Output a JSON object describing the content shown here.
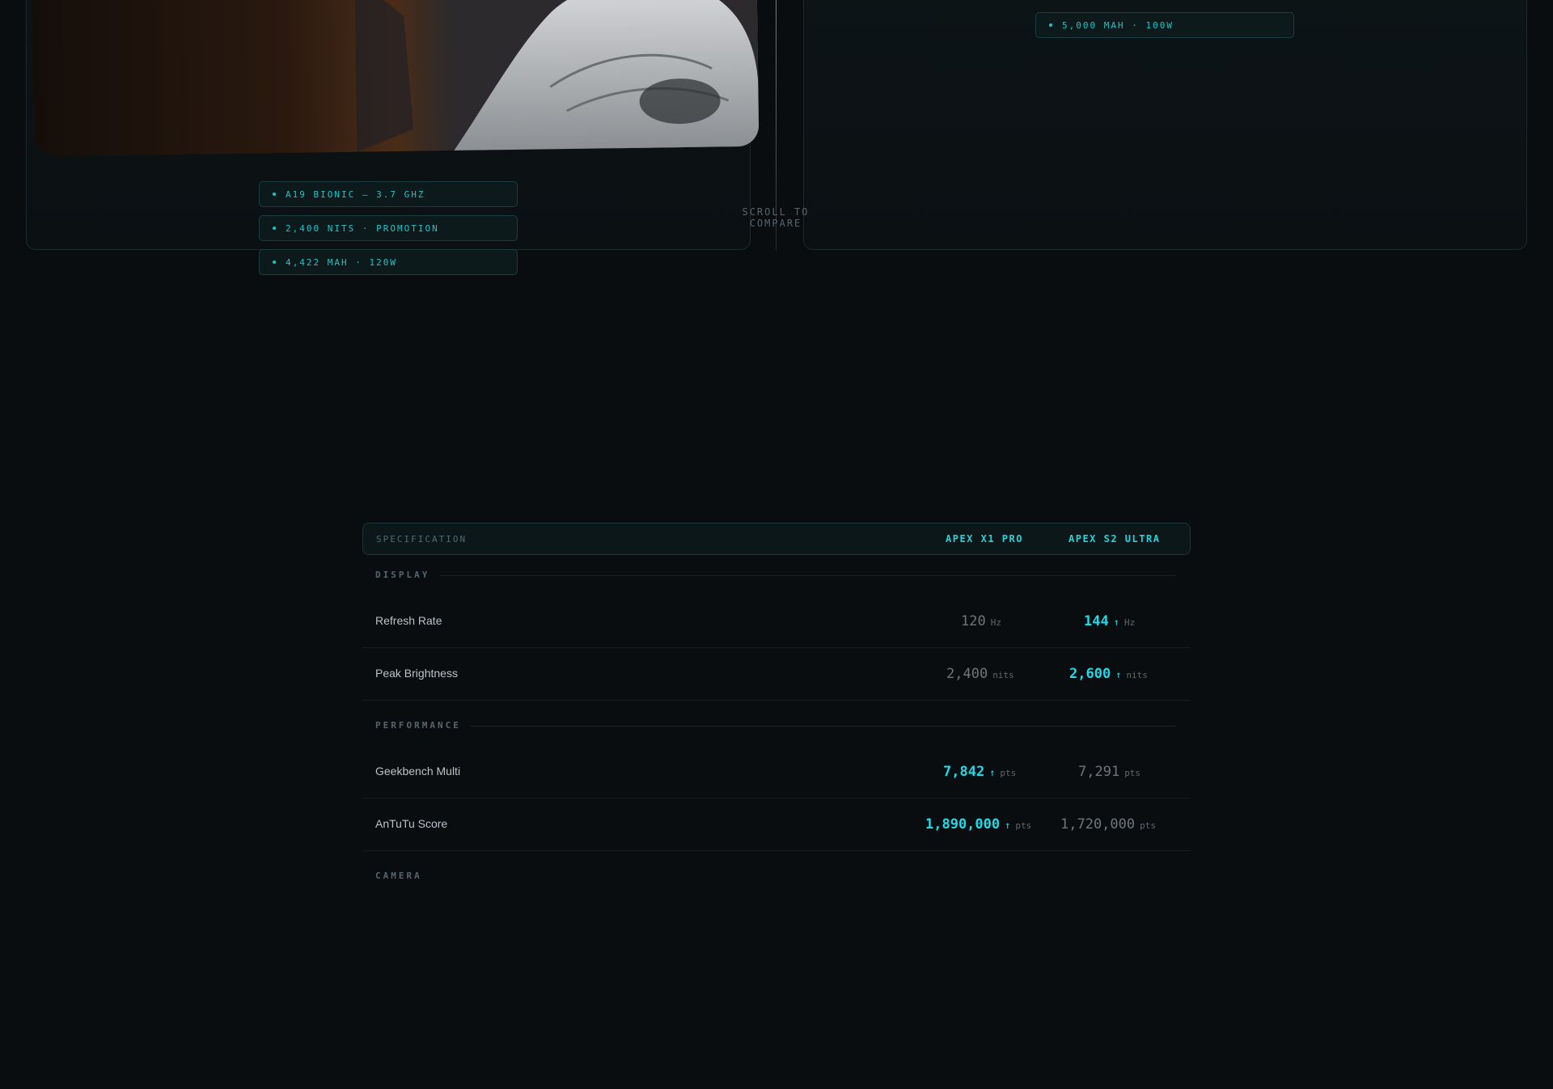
{
  "hero": {
    "left_specs": [
      "A19 BIONIC — 3.7 GHZ",
      "2,400 NITS · PROMOTION",
      "4,422 MAH · 120W"
    ],
    "right_specs": [
      "5,000 MAH · 100W"
    ],
    "scroll_hint": "SCROLL TO COMPARE"
  },
  "table": {
    "header": {
      "label": "SPECIFICATION",
      "col1": "APEX X1 PRO",
      "col2": "APEX S2 ULTRA"
    },
    "sections": [
      {
        "title": "DISPLAY",
        "rows": [
          {
            "name": "Refresh Rate",
            "v1": "120",
            "v2": "144",
            "unit": "Hz",
            "winner": 2
          },
          {
            "name": "Peak Brightness",
            "v1": "2,400",
            "v2": "2,600",
            "unit": "nits",
            "winner": 2
          }
        ]
      },
      {
        "title": "PERFORMANCE",
        "rows": [
          {
            "name": "Geekbench Multi",
            "v1": "7,842",
            "v2": "7,291",
            "unit": "pts",
            "winner": 1
          },
          {
            "name": "AnTuTu Score",
            "v1": "1,890,000",
            "v2": "1,720,000",
            "unit": "pts",
            "winner": 1
          }
        ]
      },
      {
        "title": "CAMERA"
      }
    ],
    "arrow": "↑"
  },
  "colors": {
    "accent": "#22d9e6",
    "background": "#0a0d10",
    "muted": "#6d767c"
  }
}
